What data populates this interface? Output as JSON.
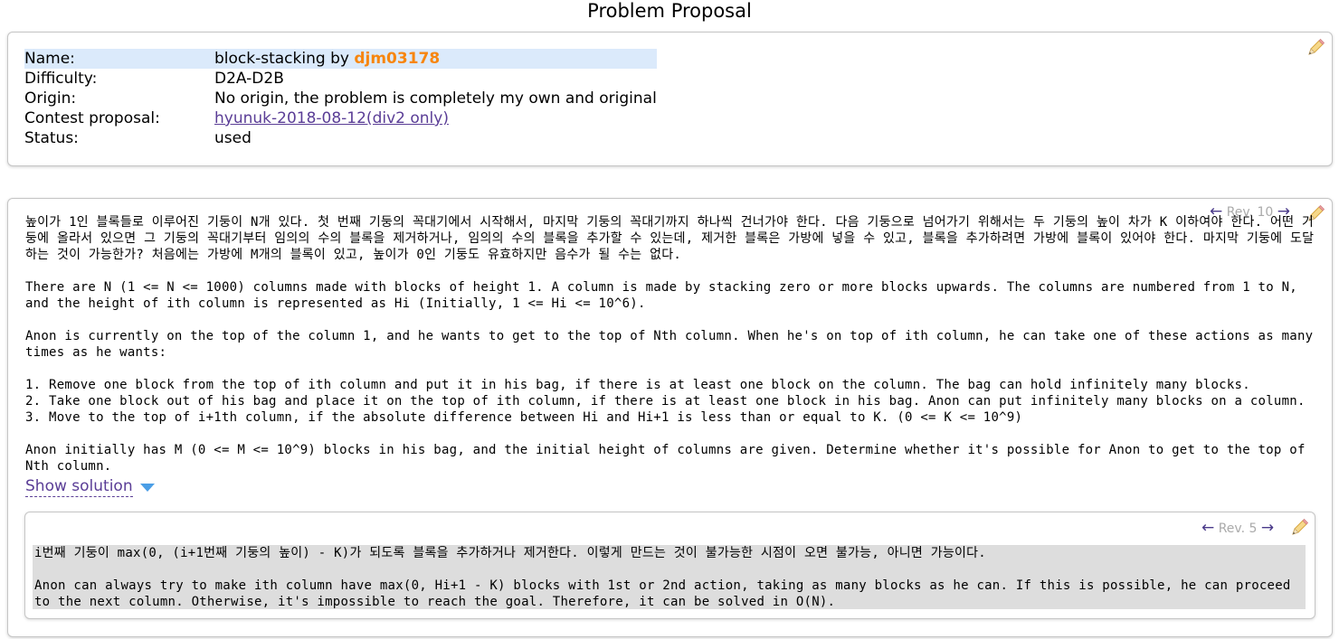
{
  "page": {
    "title": "Problem Proposal"
  },
  "info": {
    "name_label": "Name:",
    "name_value": "block-stacking by ",
    "author": "djm03178",
    "difficulty_label": "Difficulty:",
    "difficulty_value": "D2A-D2B",
    "origin_label": "Origin:",
    "origin_value": "No origin, the problem is completely my own and original",
    "contest_label": "Contest proposal:",
    "contest_value": "hyunuk-2018-08-12(div2 only)",
    "status_label": "Status:",
    "status_value": "used"
  },
  "statement": {
    "revision": {
      "prev": "←",
      "label": "Rev. 10",
      "next": "→"
    },
    "paragraphs": [
      "높이가 1인 블록들로 이루어진 기둥이 N개 있다. 첫 번째 기둥의 꼭대기에서 시작해서, 마지막 기둥의 꼭대기까지 하나씩 건너가야 한다. 다음 기둥으로 넘어가기 위해서는 두 기둥의 높이 차가 K 이하여야 한다. 어떤 기둥에 올라서 있으면 그 기둥의 꼭대기부터 임의의 수의 블록을 제거하거나, 임의의 수의 블록을 추가할 수 있는데, 제거한 블록은 가방에 넣을 수 있고, 블록을 추가하려면 가방에 블록이 있어야 한다. 마지막 기둥에 도달하는 것이 가능한가? 처음에는 가방에 M개의 블록이 있고, 높이가 0인 기둥도 유효하지만 음수가 될 수는 없다.",
      "There are N (1 <= N <= 1000) columns made with blocks of height 1. A column is made by stacking zero or more blocks upwards. The columns are numbered from 1 to N, and the height of ith column is represented as Hi (Initially, 1 <= Hi <= 10^6).",
      "Anon is currently on the top of the column 1, and he wants to get to the top of Nth column. When he's on top of ith column, he can take one of these actions as many times as he wants:",
      "1. Remove one block from the top of ith column and put it in his bag, if there is at least one block on the column. The bag can hold infinitely many blocks.\n2. Take one block out of his bag and place it on the top of ith column, if there is at least one block in his bag. Anon can put infinitely many blocks on a column.\n3. Move to the top of i+1th column, if the absolute difference between Hi and Hi+1 is less than or equal to K. (0 <= K <= 10^9)",
      "Anon initially has M (0 <= M <= 10^9) blocks in his bag, and the initial height of columns are given. Determine whether it's possible for Anon to get to the top of Nth column."
    ],
    "show_solution": "Show solution"
  },
  "solution": {
    "revision": {
      "prev": "←",
      "label": "Rev. 5",
      "next": "→"
    },
    "paragraphs": [
      "i번째 기둥이 max(0, (i+1번째 기둥의 높이) - K)가 되도록 블록을 추가하거나 제거한다. 이렇게 만드는 것이 불가능한 시점이 오면 불가능, 아니면 가능이다.",
      "Anon can always try to make ith column have max(0, Hi+1 - K) blocks with 1st or 2nd action, taking as many blocks as he can. If this is possible, he can proceed to the next column. Otherwise, it's impossible to reach the goal. Therefore, it can be solved in O(N)."
    ]
  },
  "icons": {
    "edit": "pencil-icon",
    "expand": "triangle-down-icon"
  },
  "colors": {
    "author": "#f7860f",
    "link": "#5a3d96",
    "highlight_row": "#dbeafb",
    "solution_bg": "#dddddd",
    "expand_icon": "#4a9ee6"
  }
}
